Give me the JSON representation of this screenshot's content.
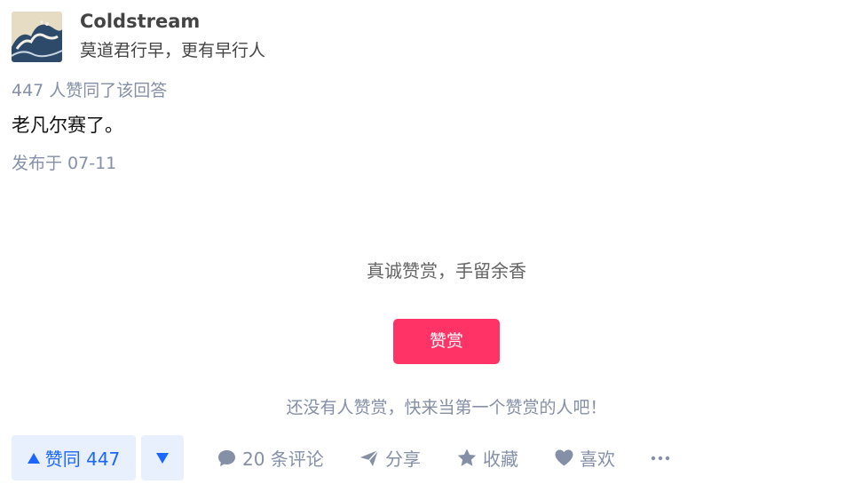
{
  "author": {
    "name": "Coldstream",
    "bio": "莫道君行早，更有早行人"
  },
  "answer": {
    "vote_summary": "447 人赞同了该回答",
    "content": "老凡尔赛了。",
    "publish_time": "发布于 07-11"
  },
  "reward": {
    "slogan": "真诚赞赏，手留余香",
    "button_label": "赞赏",
    "empty_text": "还没有人赞赏，快来当第一个赞赏的人吧！"
  },
  "actions": {
    "vote_up_label": "赞同 447",
    "comments_label": "20 条评论",
    "share_label": "分享",
    "favorite_label": "收藏",
    "like_label": "喜欢"
  },
  "colors": {
    "accent": "#1a66ff",
    "reward": "#ff3366",
    "muted": "#8590a6"
  },
  "icons": [
    "avatar-wave-image",
    "triangle-up-icon",
    "triangle-down-icon",
    "comment-bubble-icon",
    "paper-plane-icon",
    "star-icon",
    "heart-icon",
    "more-dots-icon"
  ]
}
